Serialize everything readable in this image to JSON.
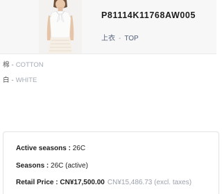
{
  "product": {
    "sku": "P81114K11768AW005",
    "category_zh": "上衣",
    "category_sep": "-",
    "category_en": "TOP"
  },
  "attributes": [
    {
      "zh": "棉",
      "sep": "-",
      "en": "COTTON"
    },
    {
      "zh": "白",
      "sep": "-",
      "en": "WHITE"
    }
  ],
  "info": {
    "active_seasons_label": "Active seasons :",
    "active_seasons_value": "26C",
    "seasons_label": "Seasons :",
    "seasons_value": "26C (active)",
    "retail_price_label": "Retail Price :",
    "retail_price_value": "CN¥17,500.00",
    "retail_price_excl": "CN¥15,486.73 (excl. taxes)"
  }
}
